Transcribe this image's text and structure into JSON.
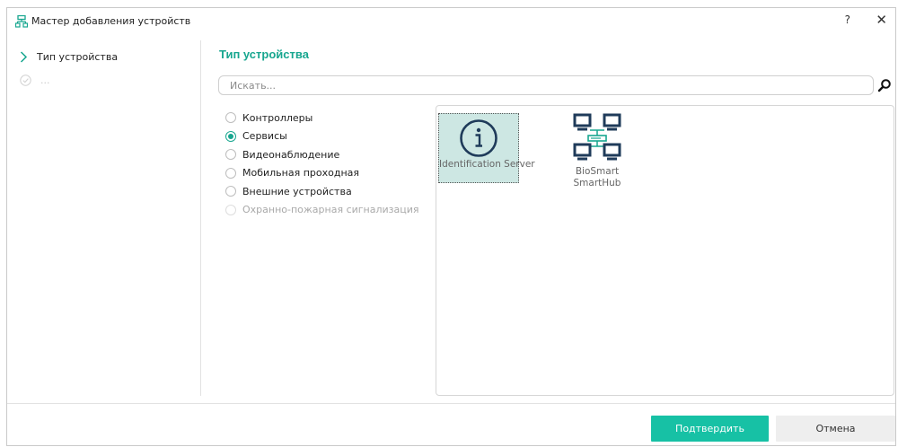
{
  "window": {
    "title": "Мастер добавления устройств",
    "help_label": "?",
    "close_label": "✕"
  },
  "colors": {
    "accent": "#17a68f",
    "button_primary": "#17c1a5",
    "selected_tile": "#cde7e3",
    "device_icon": "#1f3b5a"
  },
  "sidebar": {
    "steps": [
      {
        "label": "Тип устройства",
        "icon": "chevron-right-icon",
        "active": true
      },
      {
        "label": "...",
        "icon": "check-circle-icon",
        "active": false
      }
    ]
  },
  "main": {
    "title": "Тип устройства",
    "search": {
      "placeholder": "Искать...",
      "value": "",
      "icon": "search-icon"
    },
    "types": [
      {
        "label": "Контроллеры",
        "checked": false,
        "enabled": true
      },
      {
        "label": "Сервисы",
        "checked": true,
        "enabled": true
      },
      {
        "label": "Видеонаблюдение",
        "checked": false,
        "enabled": true
      },
      {
        "label": "Мобильная проходная",
        "checked": false,
        "enabled": true
      },
      {
        "label": "Внешние устройства",
        "checked": false,
        "enabled": true
      },
      {
        "label": "Охранно-пожарная сигнализация",
        "checked": false,
        "enabled": false
      }
    ],
    "devices": [
      {
        "label": "Identification Server",
        "icon": "info-circle-icon",
        "selected": true
      },
      {
        "label": "BioSmart SmartHub",
        "icon": "network-hub-icon",
        "selected": false
      }
    ]
  },
  "footer": {
    "confirm_label": "Подтвердить",
    "cancel_label": "Отмена"
  }
}
